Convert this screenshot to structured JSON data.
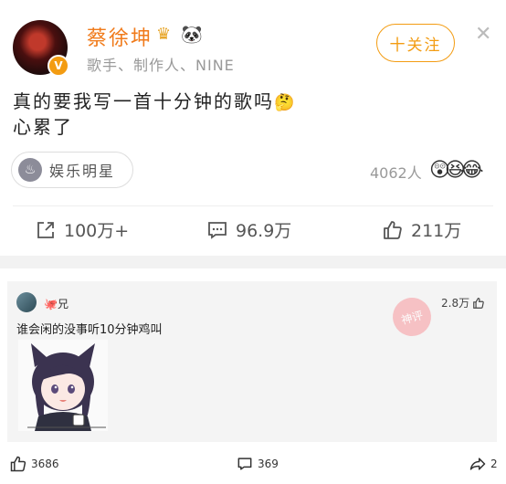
{
  "user": {
    "name": "蔡徐坤",
    "verified_badge": "V",
    "description": "歌手、制作人、NINE"
  },
  "header": {
    "follow_label": "十关注",
    "close_icon": "✕"
  },
  "post": {
    "line1": "真的要我写一首十分钟的歌吗",
    "line2": "心累了"
  },
  "topic": {
    "label": "娱乐明星"
  },
  "reactions": {
    "count": "4062人"
  },
  "actions": {
    "repost": "100万+",
    "comments": "96.9万",
    "likes": "211万"
  },
  "comment": {
    "user_suffix": "兄",
    "likes": "2.8万",
    "text": "谁会闲的没事听10分钟鸡叫",
    "stamp": "神评"
  },
  "bottom_bar": {
    "likes": "3686",
    "comments": "369",
    "shares": "2"
  }
}
